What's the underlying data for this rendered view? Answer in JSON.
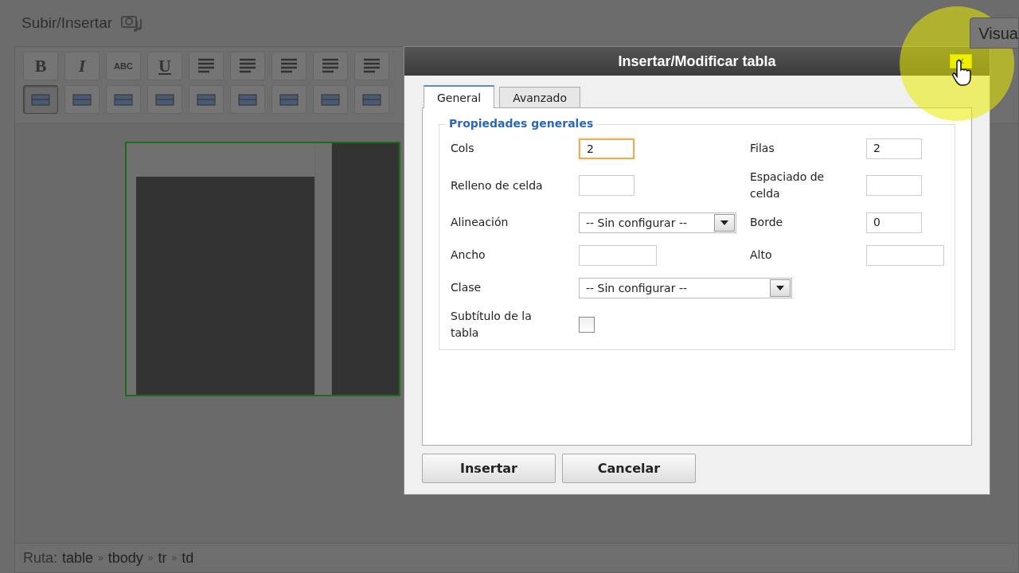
{
  "editor": {
    "upload_label": "Subir/Insertar",
    "visual_tab": "Visua",
    "format_buttons": [
      {
        "label": "B",
        "kind": "bold"
      },
      {
        "label": "I",
        "kind": "italic"
      },
      {
        "label": "ABC",
        "kind": "strike"
      },
      {
        "label": "U",
        "kind": "underline"
      }
    ],
    "path": {
      "label": "Ruta:",
      "separator": "»",
      "items": [
        "table",
        "tbody",
        "tr",
        "td"
      ]
    }
  },
  "dialog": {
    "title": "Insertar/Modificar tabla",
    "close_hovered": true,
    "tabs": [
      {
        "label": "General",
        "selected": true
      },
      {
        "label": "Avanzado",
        "selected": false
      }
    ],
    "legend": "Propiedades generales",
    "rows": [
      {
        "left": {
          "label": "Cols",
          "kind": "input",
          "value": "2",
          "focused": true
        },
        "right": {
          "label": "Filas",
          "kind": "input",
          "value": "2",
          "focused": false
        }
      },
      {
        "left": {
          "label": "Relleno de celda",
          "kind": "input",
          "focused": false
        },
        "right": {
          "label": "Espaciado de celda",
          "kind": "input",
          "focused": false
        }
      },
      {
        "left": {
          "label": "Alineación",
          "kind": "select",
          "value": "-- Sin configurar --"
        },
        "right": {
          "label": "Borde",
          "kind": "input",
          "value": "0",
          "focused": false
        }
      },
      {
        "left": {
          "label": "Ancho",
          "kind": "input",
          "focused": false,
          "wide": true
        },
        "right": {
          "label": "Alto",
          "kind": "input",
          "focused": false,
          "wide": true
        }
      },
      {
        "left": {
          "label": "Clase",
          "kind": "select",
          "value": "-- Sin configurar --",
          "wide": true
        }
      },
      {
        "left": {
          "label": "Subtítulo de la tabla",
          "kind": "checkbox",
          "checked": false
        }
      }
    ],
    "buttons": [
      {
        "label": "Insertar"
      },
      {
        "label": "Cancelar"
      }
    ]
  }
}
